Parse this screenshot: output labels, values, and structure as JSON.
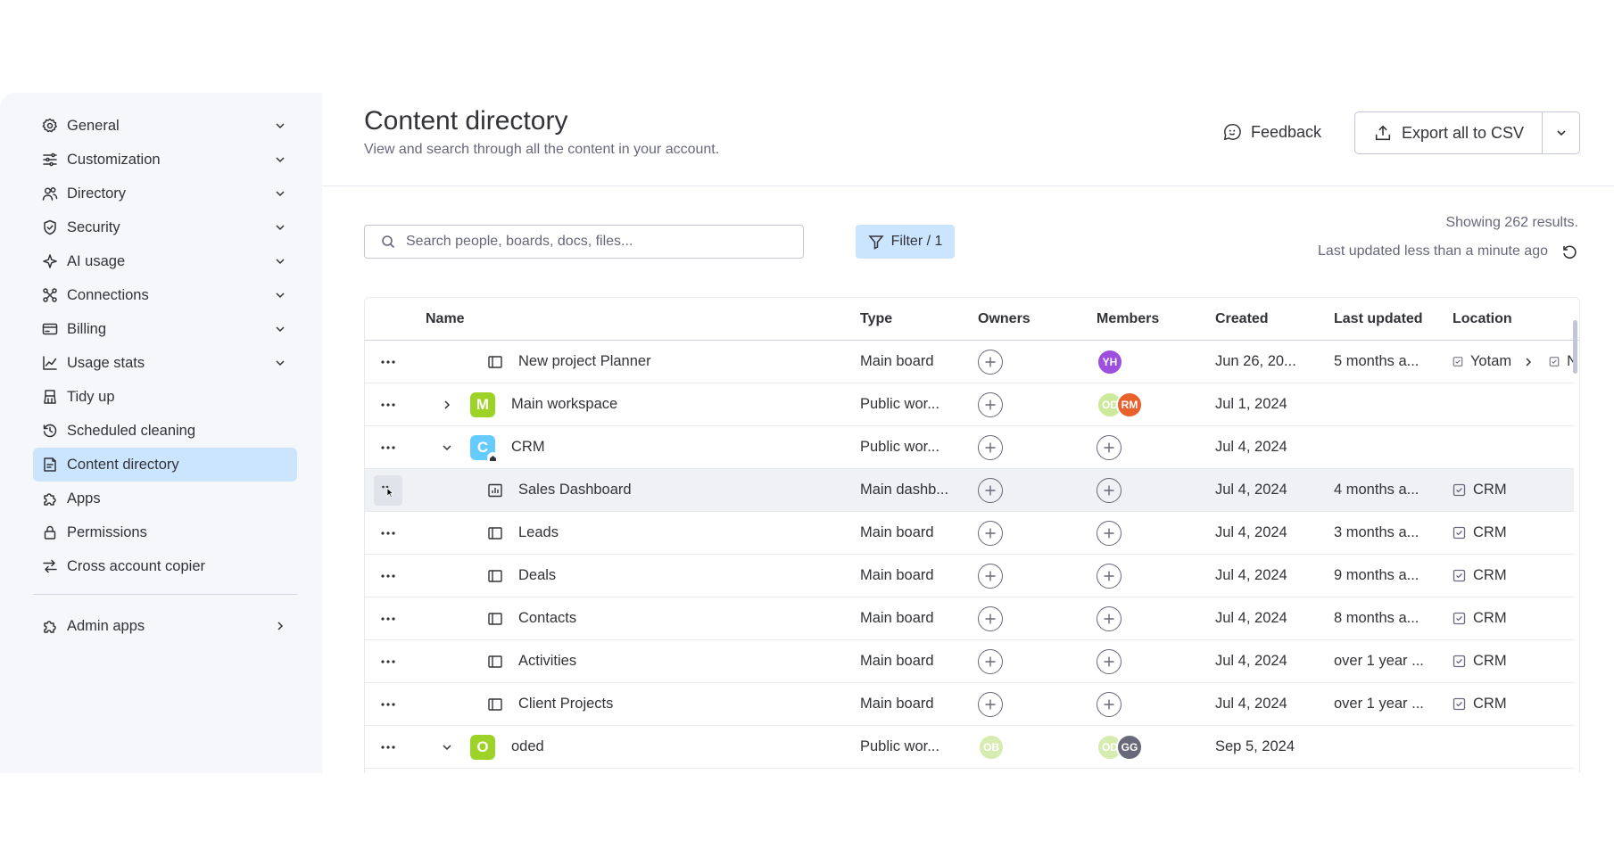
{
  "sidebar": {
    "items": [
      {
        "label": "General",
        "icon": "gear-icon",
        "chevron": "down"
      },
      {
        "label": "Customization",
        "icon": "sliders-icon",
        "chevron": "down"
      },
      {
        "label": "Directory",
        "icon": "people-icon",
        "chevron": "down"
      },
      {
        "label": "Security",
        "icon": "shield-icon",
        "chevron": "down"
      },
      {
        "label": "AI usage",
        "icon": "ai-sparkle-icon",
        "chevron": "down"
      },
      {
        "label": "Connections",
        "icon": "connections-icon",
        "chevron": "down"
      },
      {
        "label": "Billing",
        "icon": "credit-card-icon",
        "chevron": "down"
      },
      {
        "label": "Usage stats",
        "icon": "chart-line-icon",
        "chevron": "down"
      },
      {
        "label": "Tidy up",
        "icon": "broom-icon",
        "chevron": ""
      },
      {
        "label": "Scheduled cleaning",
        "icon": "history-icon",
        "chevron": ""
      },
      {
        "label": "Content directory",
        "icon": "content-directory-icon",
        "chevron": "",
        "active": true
      },
      {
        "label": "Apps",
        "icon": "puzzle-icon",
        "chevron": ""
      },
      {
        "label": "Permissions",
        "icon": "lock-icon",
        "chevron": ""
      },
      {
        "label": "Cross account copier",
        "icon": "arrows-swap-icon",
        "chevron": ""
      }
    ],
    "admin_apps": {
      "label": "Admin apps",
      "icon": "puzzle-icon"
    }
  },
  "header": {
    "title": "Content directory",
    "subtitle": "View and search through all the content in your account.",
    "feedback_label": "Feedback",
    "export_label": "Export all to CSV"
  },
  "toolbar": {
    "search_placeholder": "Search people, boards, docs, files...",
    "filter_label": "Filter / 1",
    "showing": "Showing 262 results.",
    "last_updated": "Last updated less than a minute ago"
  },
  "table": {
    "columns": [
      "Name",
      "Type",
      "Owners",
      "Members",
      "Created",
      "Last updated",
      "Location"
    ],
    "rows": [
      {
        "kind": "board",
        "icon": "board-icon",
        "name": "New project Planner",
        "type": "Main board",
        "owners": "plus",
        "members": [
          {
            "initials": "YH",
            "color": "#9d50dd"
          }
        ],
        "created": "Jun 26, 20...",
        "updated": "5 months a...",
        "location": "Yotam",
        "location_extra": "N"
      },
      {
        "kind": "workspace",
        "letter": "M",
        "ws_color": "#9cd326",
        "expand": "right",
        "name": "Main workspace",
        "type": "Public wor...",
        "owners": "plus",
        "members": [
          {
            "initials": "OD",
            "color": "#cde99b"
          },
          {
            "initials": "RM",
            "color": "#e8612c"
          }
        ],
        "created": "Jul 1, 2024",
        "updated": "",
        "location": ""
      },
      {
        "kind": "workspace",
        "letter": "C",
        "ws_color": "#66ccff",
        "expand": "down",
        "home": true,
        "name": "CRM",
        "type": "Public wor...",
        "owners": "plus",
        "members": "plus",
        "created": "Jul 4, 2024",
        "updated": "",
        "location": ""
      },
      {
        "kind": "board",
        "icon": "dashboard-icon",
        "hover": true,
        "name": "Sales Dashboard",
        "type": "Main dashb...",
        "owners": "plus",
        "members": "plus",
        "created": "Jul 4, 2024",
        "updated": "4 months a...",
        "location": "CRM"
      },
      {
        "kind": "board",
        "icon": "board-icon",
        "name": "Leads",
        "type": "Main board",
        "owners": "plus",
        "members": "plus",
        "created": "Jul 4, 2024",
        "updated": "3 months a...",
        "location": "CRM"
      },
      {
        "kind": "board",
        "icon": "board-icon",
        "name": "Deals",
        "type": "Main board",
        "owners": "plus",
        "members": "plus",
        "created": "Jul 4, 2024",
        "updated": "9 months a...",
        "location": "CRM"
      },
      {
        "kind": "board",
        "icon": "board-icon",
        "name": "Contacts",
        "type": "Main board",
        "owners": "plus",
        "members": "plus",
        "created": "Jul 4, 2024",
        "updated": "8 months a...",
        "location": "CRM"
      },
      {
        "kind": "board",
        "icon": "board-icon",
        "name": "Activities",
        "type": "Main board",
        "owners": "plus",
        "members": "plus",
        "created": "Jul 4, 2024",
        "updated": "over 1 year ...",
        "location": "CRM"
      },
      {
        "kind": "board",
        "icon": "board-icon",
        "name": "Client Projects",
        "type": "Main board",
        "owners": "plus",
        "members": "plus",
        "created": "Jul 4, 2024",
        "updated": "over 1 year ...",
        "location": "CRM"
      },
      {
        "kind": "workspace",
        "letter": "O",
        "ws_color": "#9cd326",
        "expand": "down",
        "name": "oded",
        "type": "Public wor...",
        "owners": [
          {
            "initials": "OB",
            "color": "#d6ecb0"
          }
        ],
        "members": [
          {
            "initials": "OD",
            "color": "#d6ecb0"
          },
          {
            "initials": "GG",
            "color": "#676879"
          }
        ],
        "created": "Sep 5, 2024",
        "updated": "",
        "location": ""
      }
    ]
  }
}
